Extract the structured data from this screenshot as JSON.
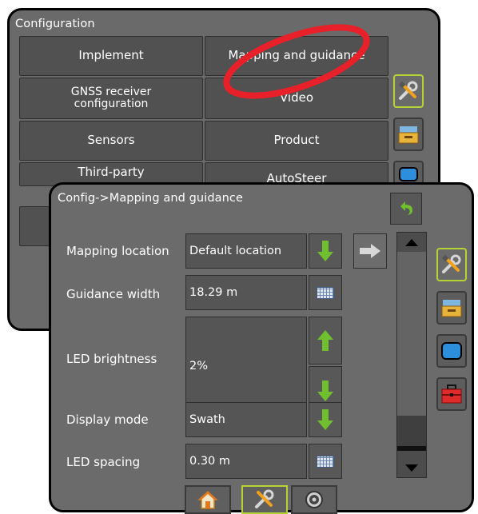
{
  "back_window": {
    "title": "Configuration",
    "buttons": [
      {
        "label": "Implement"
      },
      {
        "label": "Mapping and guidance"
      },
      {
        "label": "GNSS receiver configuration"
      },
      {
        "label": "Video"
      },
      {
        "label": "Sensors"
      },
      {
        "label": "Product"
      },
      {
        "label": "Third-party"
      },
      {
        "label": "AutoSteer"
      }
    ],
    "side_tabs": [
      "tools-icon",
      "console-icon",
      "display-icon"
    ]
  },
  "front_window": {
    "title": "Config->Mapping and guidance",
    "rows": [
      {
        "label": "Mapping location",
        "value": "Default location"
      },
      {
        "label": "Guidance width",
        "value": "18.29 m"
      },
      {
        "label": "LED brightness",
        "value": "2%"
      },
      {
        "label": "Display mode",
        "value": "Swath"
      },
      {
        "label": "LED spacing",
        "value": "0.30 m"
      }
    ],
    "side_tabs": [
      "tools-icon",
      "console-icon",
      "display-icon",
      "toolbox-icon"
    ],
    "bottom_tabs": [
      "home-icon",
      "tools-icon",
      "gauge-icon"
    ]
  },
  "annotation": {
    "color": "#e8202a",
    "target": "Mapping and guidance"
  },
  "colors": {
    "accent": "#b5d334",
    "arrow_green": "#6fbf2e"
  }
}
